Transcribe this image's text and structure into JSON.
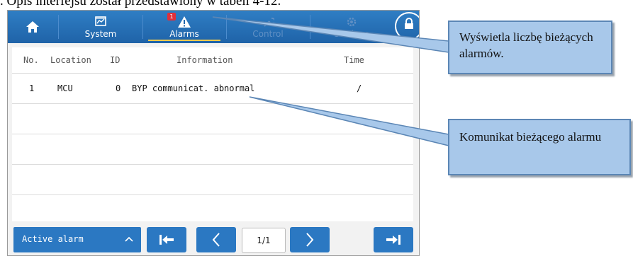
{
  "doc_caption": ". Opis interfejsu został przedstawiony w tabeli 4-12.",
  "tabs": {
    "home_icon": "home-icon",
    "system": "System",
    "alarms": "Alarms",
    "control": "Control",
    "settings": "Settings",
    "alarm_count": "1"
  },
  "table": {
    "headers": [
      "No.",
      "Location",
      "ID",
      "Information",
      "Time"
    ],
    "rows": [
      {
        "no": "1",
        "location": "MCU",
        "id": "0",
        "info": "BYP communicat. abnormal",
        "time": "/"
      }
    ]
  },
  "bottom": {
    "filter_label": "Active alarm",
    "page": "1/1"
  },
  "callouts": {
    "alarm_count_desc": "Wyświetla liczbę bieżących alarmów.",
    "alarm_message_desc": "Komunikat bieżącego alarmu"
  },
  "colors": {
    "topbar": "#2470b8",
    "button": "#2b78c2",
    "badge": "#e0303a",
    "callout": "#a8c8ea"
  }
}
